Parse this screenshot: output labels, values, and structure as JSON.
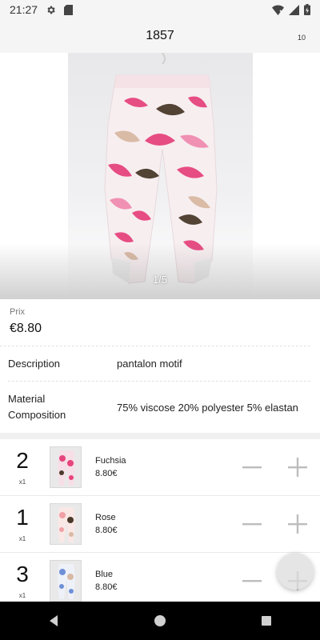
{
  "status_bar": {
    "time": "21:27",
    "icons": [
      "settings-icon",
      "sd-card-icon",
      "wifi-off-icon",
      "signal-icon",
      "battery-charging-icon"
    ]
  },
  "app_bar": {
    "title": "1857",
    "count": "10"
  },
  "gallery": {
    "counter": "1/5"
  },
  "product": {
    "price_label": "Prix",
    "price_value": "€8.80",
    "description_label": "Description",
    "description_value": "pantalon motif",
    "material_label_line1": "Material",
    "material_label_line2": "Composition",
    "material_value": "75% viscose 20% polyester 5% elastan"
  },
  "variants": [
    {
      "qty": "2",
      "multiplier": "x1",
      "name": "Fuchsia",
      "price": "8.80€",
      "swatch": "#e6457e"
    },
    {
      "qty": "1",
      "multiplier": "x1",
      "name": "Rose",
      "price": "8.80€",
      "swatch": "#f1a0a5"
    },
    {
      "qty": "3",
      "multiplier": "x1",
      "name": "Blue",
      "price": "8.80€",
      "swatch": "#6f8fd6"
    }
  ],
  "colors": {
    "accent_pink": "#e6457e",
    "leaf_brown": "#4a3a2a",
    "leaf_tan": "#d8b9a3",
    "control_grey": "#bdbdbd"
  }
}
